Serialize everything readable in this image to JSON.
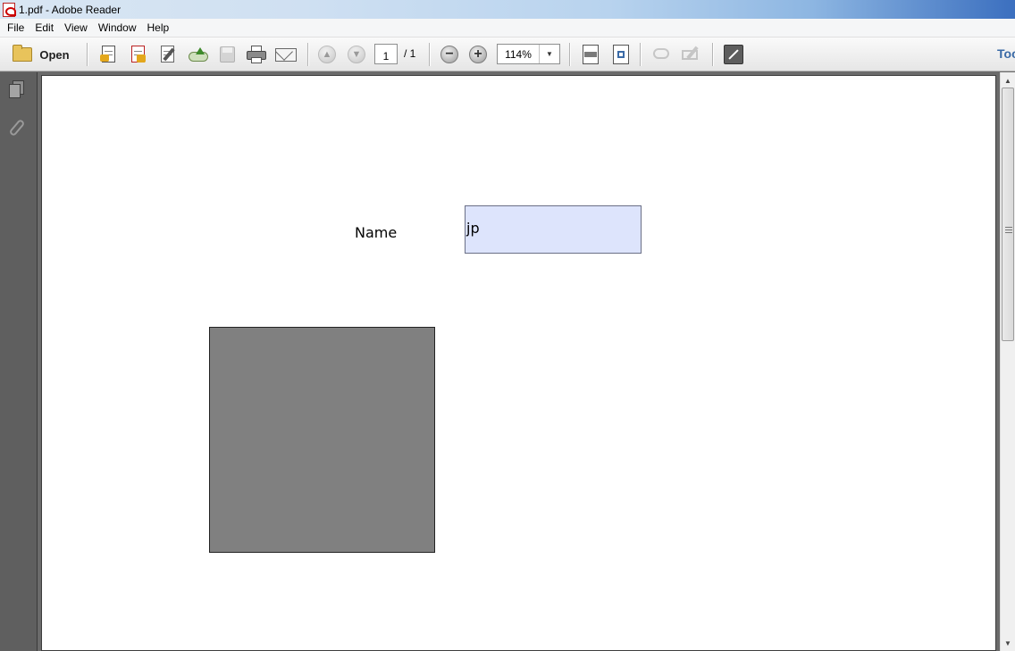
{
  "window": {
    "title": "1.pdf - Adobe Reader"
  },
  "menu": {
    "items": [
      "File",
      "Edit",
      "View",
      "Window",
      "Help"
    ]
  },
  "toolbar": {
    "open_label": "Open",
    "page_current": "1",
    "page_total": "/ 1",
    "zoom_value": "114%",
    "tools_label": "Too"
  },
  "document": {
    "name_label": "Name",
    "name_value": "jp"
  },
  "colors": {
    "form_field_bg": "#dde4fc",
    "box_gray": "#808080",
    "nav_pane": "#5f5f5f"
  }
}
